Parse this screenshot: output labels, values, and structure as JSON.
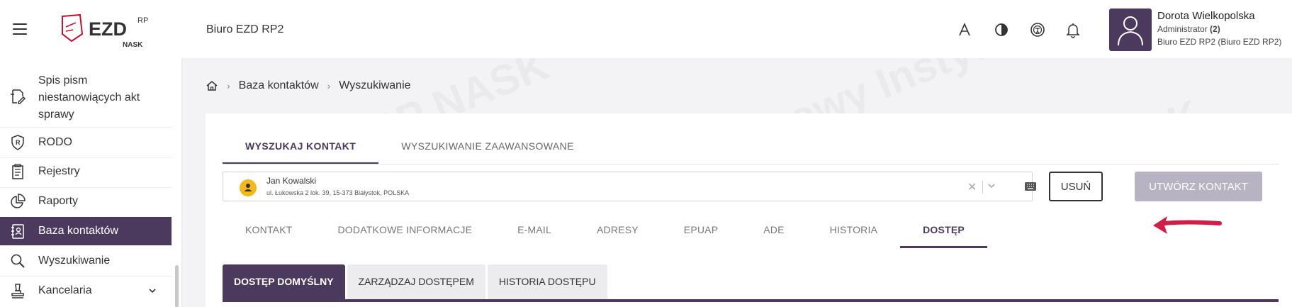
{
  "header": {
    "office": "Biuro EZD RP2",
    "logo": {
      "main": "EZD",
      "super": "RP",
      "sub": "NASK"
    },
    "user": {
      "name": "Dorota Wielkopolska",
      "role": "Administrator",
      "role_count": "(2)",
      "unit": "Biuro EZD RP2 (Biuro EZD RP2)"
    },
    "icons": [
      "font-size-icon",
      "contrast-icon",
      "accessibility-icon",
      "bell-icon"
    ]
  },
  "sidebar": {
    "items": [
      {
        "label": "Spis pism niestanowiących akt sprawy",
        "icon": "document-edit-icon"
      },
      {
        "label": "RODO",
        "icon": "rodo-shield-icon"
      },
      {
        "label": "Rejestry",
        "icon": "registry-icon"
      },
      {
        "label": "Raporty",
        "icon": "pie-chart-icon"
      },
      {
        "label": "Baza kontaktów",
        "icon": "contacts-icon",
        "active": true
      },
      {
        "label": "Wyszukiwanie",
        "icon": "search-icon"
      },
      {
        "label": "Kancelaria",
        "icon": "stamp-icon"
      }
    ]
  },
  "breadcrumb": {
    "items": [
      "Baza kontaktów",
      "Wyszukiwanie"
    ]
  },
  "main_tabs": [
    "WYSZUKAJ KONTAKT",
    "WYSZUKIWANIE ZAAWANSOWANE"
  ],
  "contact": {
    "name": "Jan Kowalski",
    "address": "ul. Łukowska 2 lok. 39, 15-373 Białystok, POLSKA"
  },
  "buttons": {
    "remove": "USUŃ",
    "create": "UTWÓRZ KONTAKT"
  },
  "sub_tabs": [
    "KONTAKT",
    "DODATKOWE INFORMACJE",
    "E-MAIL",
    "ADRESY",
    "EPUAP",
    "ADE",
    "HISTORIA",
    "DOSTĘP"
  ],
  "access_tabs": [
    "DOSTĘP DOMYŚLNY",
    "ZARZĄDZAJ DOSTĘPEM",
    "HISTORIA DOSTĘPU"
  ],
  "colors": {
    "primary": "#4b3a5d",
    "create_disabled": "#b7b3c2",
    "arrow": "#d21e47",
    "contact_avatar": "#f3b81b"
  }
}
